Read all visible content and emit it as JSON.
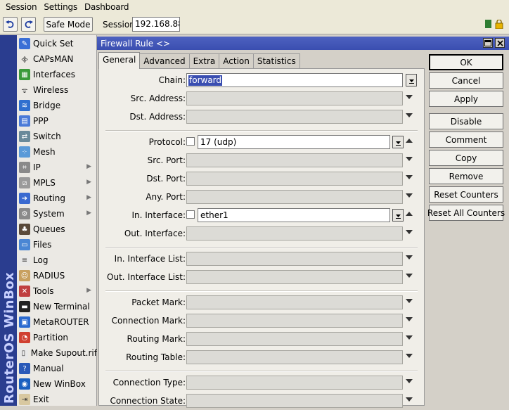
{
  "menu": {
    "session": "Session",
    "settings": "Settings",
    "dashboard": "Dashboard"
  },
  "toolbar": {
    "safe_mode": "Safe Mode",
    "session_label": "Session:",
    "session_value": "192.168.88.1"
  },
  "vertical_brand": "RouterOS WinBox",
  "sidebar": {
    "items": [
      {
        "label": "Quick Set",
        "icon": "quick-set-icon"
      },
      {
        "label": "CAPsMAN",
        "icon": "capsman-icon"
      },
      {
        "label": "Interfaces",
        "icon": "interfaces-icon"
      },
      {
        "label": "Wireless",
        "icon": "wireless-icon"
      },
      {
        "label": "Bridge",
        "icon": "bridge-icon"
      },
      {
        "label": "PPP",
        "icon": "ppp-icon"
      },
      {
        "label": "Switch",
        "icon": "switch-icon"
      },
      {
        "label": "Mesh",
        "icon": "mesh-icon"
      },
      {
        "label": "IP",
        "icon": "ip-icon",
        "submenu": true
      },
      {
        "label": "MPLS",
        "icon": "mpls-icon",
        "submenu": true
      },
      {
        "label": "Routing",
        "icon": "routing-icon",
        "submenu": true
      },
      {
        "label": "System",
        "icon": "system-icon",
        "submenu": true
      },
      {
        "label": "Queues",
        "icon": "queues-icon"
      },
      {
        "label": "Files",
        "icon": "files-icon"
      },
      {
        "label": "Log",
        "icon": "log-icon"
      },
      {
        "label": "RADIUS",
        "icon": "radius-icon"
      },
      {
        "label": "Tools",
        "icon": "tools-icon",
        "submenu": true
      },
      {
        "label": "New Terminal",
        "icon": "terminal-icon"
      },
      {
        "label": "MetaROUTER",
        "icon": "metarouter-icon"
      },
      {
        "label": "Partition",
        "icon": "partition-icon"
      },
      {
        "label": "Make Supout.rif",
        "icon": "supout-icon"
      },
      {
        "label": "Manual",
        "icon": "manual-icon"
      },
      {
        "label": "New WinBox",
        "icon": "winbox-icon"
      },
      {
        "label": "Exit",
        "icon": "exit-icon"
      }
    ]
  },
  "window": {
    "title": "Firewall Rule <>",
    "tabs": [
      "General",
      "Advanced",
      "Extra",
      "Action",
      "Statistics"
    ],
    "fields": {
      "chain": {
        "label": "Chain:",
        "value": "forward"
      },
      "src_address": "Src. Address:",
      "dst_address": "Dst. Address:",
      "protocol": {
        "label": "Protocol:",
        "value": "17 (udp)"
      },
      "src_port": "Src. Port:",
      "dst_port": "Dst. Port:",
      "any_port": "Any. Port:",
      "in_interface": {
        "label": "In. Interface:",
        "value": "ether1"
      },
      "out_interface": "Out. Interface:",
      "in_interface_list": "In. Interface List:",
      "out_interface_list": "Out. Interface List:",
      "packet_mark": "Packet Mark:",
      "connection_mark": "Connection Mark:",
      "routing_mark": "Routing Mark:",
      "routing_table": "Routing Table:",
      "connection_type": "Connection Type:",
      "connection_state": "Connection State:"
    },
    "buttons": {
      "ok": "OK",
      "cancel": "Cancel",
      "apply": "Apply",
      "disable": "Disable",
      "comment": "Comment",
      "copy": "Copy",
      "remove": "Remove",
      "reset_counters": "Reset Counters",
      "reset_all_counters": "Reset All Counters"
    }
  },
  "colors": {
    "title_bar": "#3a4eb0",
    "brand_bar": "#2a3d8f",
    "safe_status": "#2e7d32",
    "lock": "#d8a800"
  }
}
